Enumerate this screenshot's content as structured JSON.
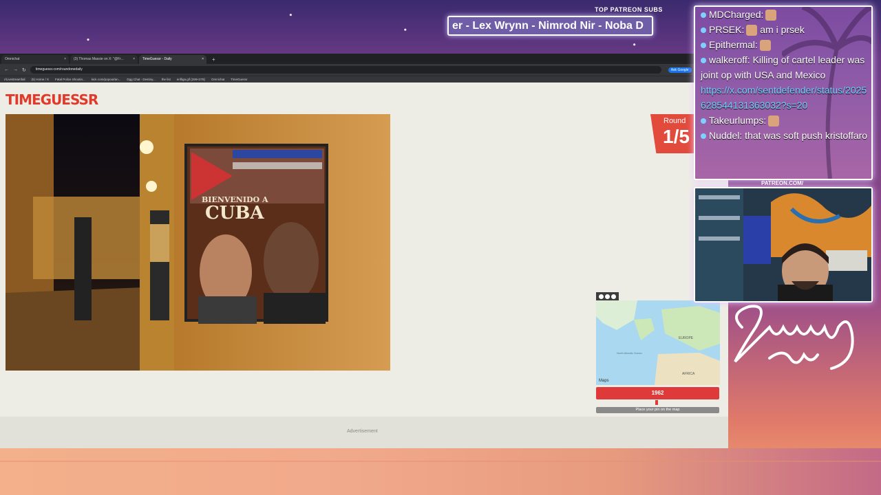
{
  "overlay": {
    "patreon_title": "TOP PATREON SUBS",
    "ticker_text": "er - Lex Wrynn - Nimrod Nir - Noba D",
    "patreon_url": "PATREON.COM/"
  },
  "browser": {
    "tabs": [
      {
        "label": "Omnichat"
      },
      {
        "label": "(3) Thomas Massie on X: \"@Fr..."
      },
      {
        "label": "TimeGuessr - Daily"
      }
    ],
    "address": "timeguessr.com/roundonedaily",
    "ask_google": "Ask Google",
    "bookmarks": [
      "r/Livestreamfail",
      "(5) Home / X",
      "Fatal Police Shootin...",
      "kick.com/popout/an...",
      "Dgg Chat - Destiny...",
      "the list",
      "enfliga.gif (299×278)",
      "Omnichat",
      "TimeGuessr"
    ]
  },
  "game": {
    "logo": "TIMEGUESSR",
    "round_label": "Round",
    "round_value": "1/5",
    "year": "1962",
    "place_pin": "Place your pin on the map",
    "advertisement": "Advertisement",
    "map_attribution": "Maps",
    "map_labels": {
      "ocean": "North Atlantic Ocean",
      "europe": "EUROPE",
      "africa": "AFRICA"
    },
    "photo_text": {
      "line1": "BIENVENIDO A",
      "line2": "CUBA"
    }
  },
  "chat": {
    "messages": [
      {
        "user": "MDCharged:",
        "text": ""
      },
      {
        "user": "PRSEK:",
        "text": "am i prsek"
      },
      {
        "user": "Epithermal:",
        "text": ""
      },
      {
        "user": "walkeroff:",
        "text": "Killing of cartel leader was joint op with USA and Mexico"
      },
      {
        "user": "",
        "text": "https://x.com/sentdefender/status/2025628544131363032?s=20",
        "link": true
      },
      {
        "user": "Takeurlumps:",
        "text": ""
      },
      {
        "user": "Nuddel:",
        "text": "that was soft push kristoffaro"
      }
    ]
  },
  "colors": {
    "accent_red": "#df3a3a",
    "link_blue": "#6fd2ff"
  }
}
